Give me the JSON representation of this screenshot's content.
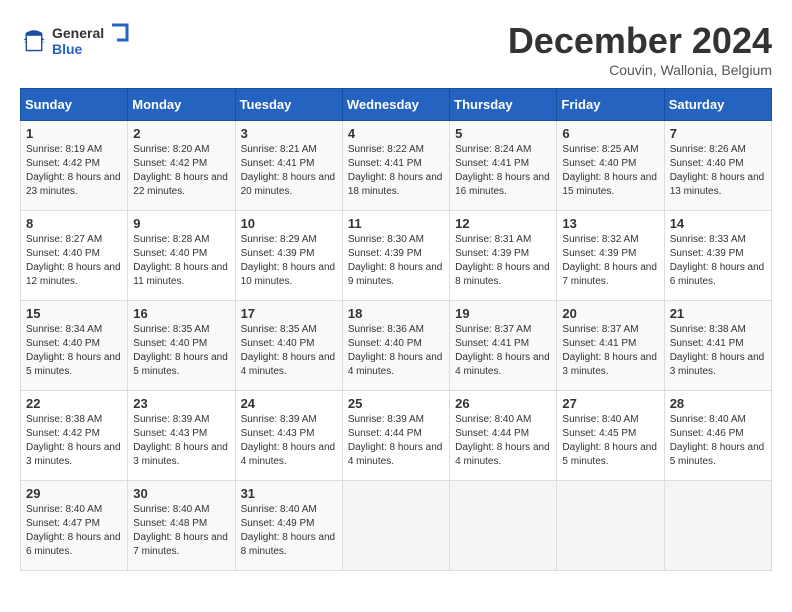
{
  "header": {
    "logo_general": "General",
    "logo_blue": "Blue",
    "month_title": "December 2024",
    "subtitle": "Couvin, Wallonia, Belgium"
  },
  "days_of_week": [
    "Sunday",
    "Monday",
    "Tuesday",
    "Wednesday",
    "Thursday",
    "Friday",
    "Saturday"
  ],
  "weeks": [
    [
      {
        "day": "1",
        "sunrise": "8:19 AM",
        "sunset": "4:42 PM",
        "daylight": "8 hours and 23 minutes."
      },
      {
        "day": "2",
        "sunrise": "8:20 AM",
        "sunset": "4:42 PM",
        "daylight": "8 hours and 22 minutes."
      },
      {
        "day": "3",
        "sunrise": "8:21 AM",
        "sunset": "4:41 PM",
        "daylight": "8 hours and 20 minutes."
      },
      {
        "day": "4",
        "sunrise": "8:22 AM",
        "sunset": "4:41 PM",
        "daylight": "8 hours and 18 minutes."
      },
      {
        "day": "5",
        "sunrise": "8:24 AM",
        "sunset": "4:41 PM",
        "daylight": "8 hours and 16 minutes."
      },
      {
        "day": "6",
        "sunrise": "8:25 AM",
        "sunset": "4:40 PM",
        "daylight": "8 hours and 15 minutes."
      },
      {
        "day": "7",
        "sunrise": "8:26 AM",
        "sunset": "4:40 PM",
        "daylight": "8 hours and 13 minutes."
      }
    ],
    [
      {
        "day": "8",
        "sunrise": "8:27 AM",
        "sunset": "4:40 PM",
        "daylight": "8 hours and 12 minutes."
      },
      {
        "day": "9",
        "sunrise": "8:28 AM",
        "sunset": "4:40 PM",
        "daylight": "8 hours and 11 minutes."
      },
      {
        "day": "10",
        "sunrise": "8:29 AM",
        "sunset": "4:39 PM",
        "daylight": "8 hours and 10 minutes."
      },
      {
        "day": "11",
        "sunrise": "8:30 AM",
        "sunset": "4:39 PM",
        "daylight": "8 hours and 9 minutes."
      },
      {
        "day": "12",
        "sunrise": "8:31 AM",
        "sunset": "4:39 PM",
        "daylight": "8 hours and 8 minutes."
      },
      {
        "day": "13",
        "sunrise": "8:32 AM",
        "sunset": "4:39 PM",
        "daylight": "8 hours and 7 minutes."
      },
      {
        "day": "14",
        "sunrise": "8:33 AM",
        "sunset": "4:39 PM",
        "daylight": "8 hours and 6 minutes."
      }
    ],
    [
      {
        "day": "15",
        "sunrise": "8:34 AM",
        "sunset": "4:40 PM",
        "daylight": "8 hours and 5 minutes."
      },
      {
        "day": "16",
        "sunrise": "8:35 AM",
        "sunset": "4:40 PM",
        "daylight": "8 hours and 5 minutes."
      },
      {
        "day": "17",
        "sunrise": "8:35 AM",
        "sunset": "4:40 PM",
        "daylight": "8 hours and 4 minutes."
      },
      {
        "day": "18",
        "sunrise": "8:36 AM",
        "sunset": "4:40 PM",
        "daylight": "8 hours and 4 minutes."
      },
      {
        "day": "19",
        "sunrise": "8:37 AM",
        "sunset": "4:41 PM",
        "daylight": "8 hours and 4 minutes."
      },
      {
        "day": "20",
        "sunrise": "8:37 AM",
        "sunset": "4:41 PM",
        "daylight": "8 hours and 3 minutes."
      },
      {
        "day": "21",
        "sunrise": "8:38 AM",
        "sunset": "4:41 PM",
        "daylight": "8 hours and 3 minutes."
      }
    ],
    [
      {
        "day": "22",
        "sunrise": "8:38 AM",
        "sunset": "4:42 PM",
        "daylight": "8 hours and 3 minutes."
      },
      {
        "day": "23",
        "sunrise": "8:39 AM",
        "sunset": "4:43 PM",
        "daylight": "8 hours and 3 minutes."
      },
      {
        "day": "24",
        "sunrise": "8:39 AM",
        "sunset": "4:43 PM",
        "daylight": "8 hours and 4 minutes."
      },
      {
        "day": "25",
        "sunrise": "8:39 AM",
        "sunset": "4:44 PM",
        "daylight": "8 hours and 4 minutes."
      },
      {
        "day": "26",
        "sunrise": "8:40 AM",
        "sunset": "4:44 PM",
        "daylight": "8 hours and 4 minutes."
      },
      {
        "day": "27",
        "sunrise": "8:40 AM",
        "sunset": "4:45 PM",
        "daylight": "8 hours and 5 minutes."
      },
      {
        "day": "28",
        "sunrise": "8:40 AM",
        "sunset": "4:46 PM",
        "daylight": "8 hours and 5 minutes."
      }
    ],
    [
      {
        "day": "29",
        "sunrise": "8:40 AM",
        "sunset": "4:47 PM",
        "daylight": "8 hours and 6 minutes."
      },
      {
        "day": "30",
        "sunrise": "8:40 AM",
        "sunset": "4:48 PM",
        "daylight": "8 hours and 7 minutes."
      },
      {
        "day": "31",
        "sunrise": "8:40 AM",
        "sunset": "4:49 PM",
        "daylight": "8 hours and 8 minutes."
      },
      null,
      null,
      null,
      null
    ]
  ],
  "labels": {
    "sunrise": "Sunrise:",
    "sunset": "Sunset:",
    "daylight": "Daylight:"
  }
}
